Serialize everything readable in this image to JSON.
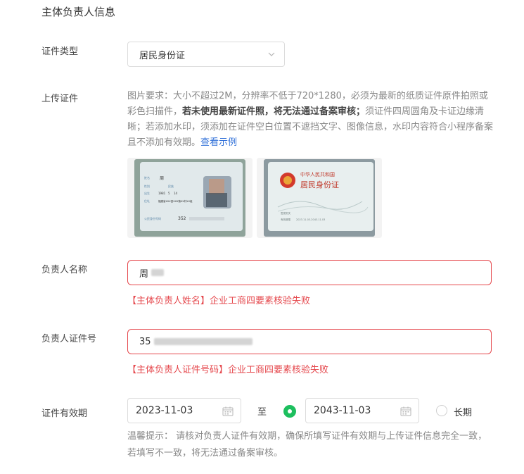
{
  "section": {
    "title": "主体负责人信息"
  },
  "id_type": {
    "label": "证件类型",
    "value": "居民身份证"
  },
  "upload": {
    "label": "上传证件",
    "req_part1": "图片要求：大小不超过2M，分辨率不低于720*1280，必须为最新的纸质证件原件拍照或彩色扫描件，",
    "req_bold": "若未使用最新证件照，将无法通过备案审核；",
    "req_part2": "须证件四周圆角及卡证边缘清晰；若添加水印，须添加在证件空白位置不遮挡文字、图像信息，水印内容符合小程序备案且不添加有效期。",
    "example_link": "查看示例",
    "front_card": {
      "tiny_labels": [
        "姓名",
        "性别",
        "民族",
        "出生",
        "住址",
        "公民身份号码"
      ],
      "name_char": "周",
      "year": "1981",
      "month": "5",
      "day": "14",
      "address": "福建省XXX县XXX镇XX村XX组",
      "id_prefix": "352"
    },
    "back_card": {
      "title": "中华人民共和国",
      "subtitle": "居民身份证",
      "field1": "签发机关",
      "field2": "有效期限",
      "validity": "2023.11.03-2043.11.03"
    }
  },
  "owner_name": {
    "label": "负责人名称",
    "value_visible": "周",
    "error": "【主体负责人姓名】企业工商四要素核验失败"
  },
  "owner_id": {
    "label": "负责人证件号",
    "value_visible": "35",
    "error": "【主体负责人证件号码】企业工商四要素核验失败"
  },
  "validity": {
    "label": "证件有效期",
    "start": "2023-11-03",
    "to": "至",
    "end": "2043-11-03",
    "long_term": "长期",
    "tip": "温馨提示： 请核对负责人证件有效期，确保所填写证件有效期与上传证件信息完全一致，若填写不一致，将无法通过备案审核。"
  },
  "colors": {
    "error": "#e5484d",
    "link": "#2f6fd8",
    "radio_active": "#1dbf5e",
    "border": "#dcdcdc"
  },
  "icons": {
    "select_arrow": "chevron-down-icon",
    "date_picker": "calendar-icon",
    "emblem": "emblem-icon"
  }
}
